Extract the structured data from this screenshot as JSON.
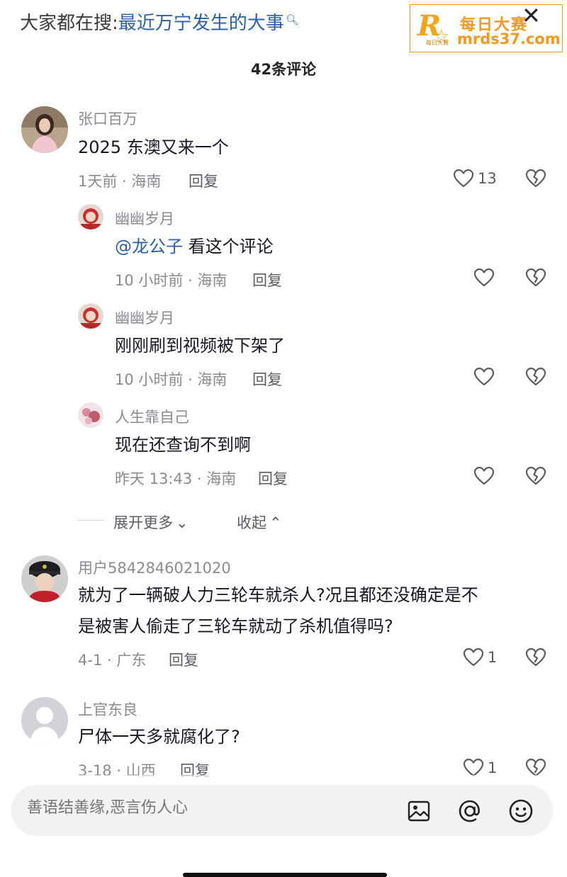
{
  "search_hint": {
    "prefix": "大家都在搜:",
    "query": "最近万宁发生的大事"
  },
  "watermark": {
    "title": "每日大赛",
    "url": "mrds37.com",
    "logo_letter": "R",
    "logo_mini": "每日大赛"
  },
  "header": {
    "comment_count": "42条评论"
  },
  "comments": [
    {
      "user": "张口百万",
      "text": "2025 东澳又来一个",
      "time_location": "1天前 · 海南",
      "reply_label": "回复",
      "likes": "13",
      "replies": [
        {
          "user": "幽幽岁月",
          "mention": "@龙公子",
          "text": " 看这个评论",
          "time_location": "10 小时前 · 海南",
          "reply_label": "回复"
        },
        {
          "user": "幽幽岁月",
          "text": "刚刚刷到视频被下架了",
          "time_location": "10 小时前 · 海南",
          "reply_label": "回复"
        },
        {
          "user": "人生靠自己",
          "text": "现在还查询不到啊",
          "time_location": "昨天 13:43 · 海南",
          "reply_label": "回复"
        }
      ],
      "expand_label": "展开更多",
      "collapse_label": "收起"
    },
    {
      "user": "用户5842846021020",
      "text_line1": "就为了一辆破人力三轮车就杀人?况且都还没确定是不",
      "text_line2": "是被害人偷走了三轮车就动了杀机值得吗?",
      "time_location": "4-1 · 广东",
      "reply_label": "回复",
      "likes": "1"
    },
    {
      "user": "上官东良",
      "text": "尸体一天多就腐化了?",
      "time_location": "3-18 · 山西",
      "reply_label": "回复",
      "likes": "1"
    }
  ],
  "input": {
    "placeholder": "善语结善缘,恶言伤人心"
  },
  "icons": {
    "close": "close-icon",
    "like": "heart-icon",
    "dislike": "broken-heart-icon",
    "image": "image-icon",
    "mention": "at-icon",
    "emoji": "emoji-icon"
  },
  "colors": {
    "mention": "#2b5fa8",
    "watermark": "#f29a1e",
    "muted": "#8a8b91"
  }
}
